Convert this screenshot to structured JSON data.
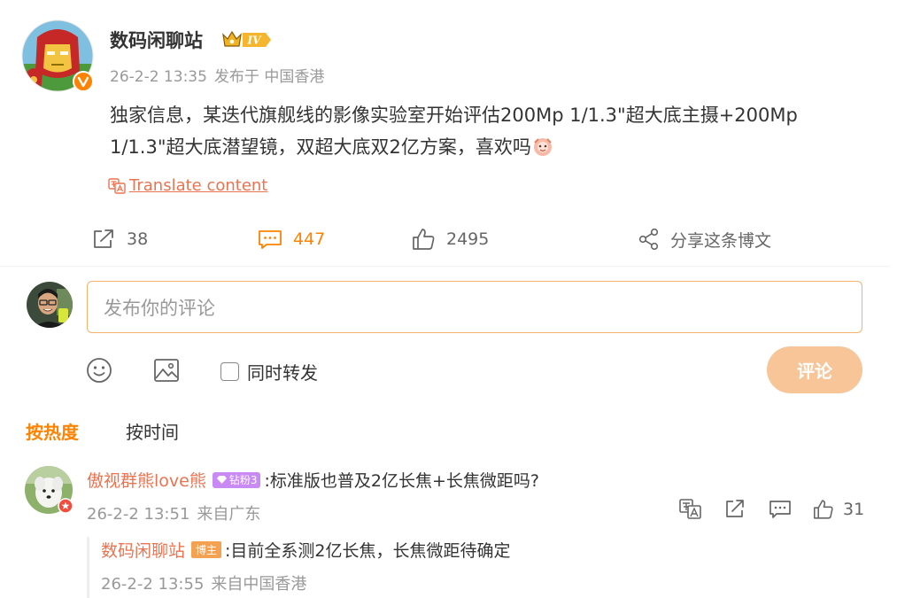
{
  "post": {
    "author": "数码闲聊站",
    "badge_level": "IV",
    "date": "26-2-2 13:35",
    "source": "发布于 中国香港",
    "content": "独家信息，某迭代旗舰线的影像实验室开始评估200Mp 1/1.3\"超大底主摄+200Mp 1/1.3\"超大底潜望镜，双超大底双2亿方案，喜欢吗",
    "translate_label": "Translate content"
  },
  "actions": {
    "repost_count": "38",
    "comment_count": "447",
    "like_count": "2495",
    "share_label": "分享这条博文"
  },
  "composer": {
    "placeholder": "发布你的评论",
    "repost_label": "同时转发",
    "submit_label": "评论"
  },
  "sort": {
    "hot_label": "按热度",
    "time_label": "按时间"
  },
  "comments": [
    {
      "user": "傲视群熊love熊",
      "badge": "钻粉3",
      "text": ":标准版也普及2亿长焦+长焦微距吗?",
      "date": "26-2-2 13:51",
      "source": "来自广东",
      "likes": "31",
      "reply": {
        "user": "数码闲聊站",
        "badge": "博主",
        "text": ":目前全系测2亿长焦，长焦微距待确定",
        "date": "26-2-2 13:55",
        "source": "来自中国香港"
      }
    }
  ],
  "colors": {
    "accent": "#ff8200",
    "link": "#eb7350",
    "muted": "#999999",
    "button_disabled": "#f8c598"
  }
}
